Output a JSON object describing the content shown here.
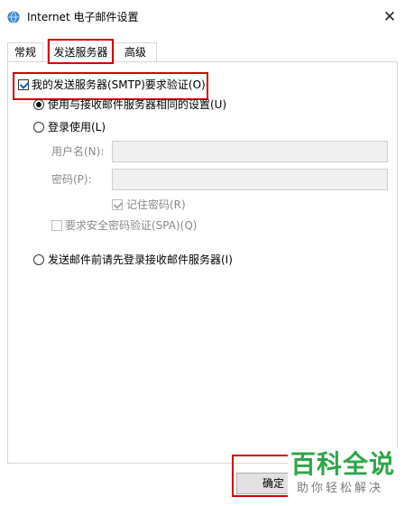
{
  "window": {
    "title": "Internet 电子邮件设置",
    "close_glyph": "✕"
  },
  "tabs": [
    {
      "label": "常规"
    },
    {
      "label": "发送服务器"
    },
    {
      "label": "高级"
    }
  ],
  "outgoing": {
    "require_auth_label": "我的发送服务器(SMTP)要求验证(O)",
    "require_auth_checked": true,
    "use_same_label": "使用与接收邮件服务器相同的设置(U)",
    "use_same_selected": true,
    "login_with_label": "登录使用(L)",
    "login_with_selected": false,
    "username_label": "用户名(N):",
    "username_value": "",
    "password_label": "密码(P):",
    "password_value": "",
    "remember_password_label": "记住密码(R)",
    "remember_password_checked": true,
    "spa_label": "要求安全密码验证(SPA)(Q)",
    "spa_checked": false,
    "login_incoming_first_label": "发送邮件前请先登录接收邮件服务器(I)",
    "login_incoming_first_selected": false
  },
  "buttons": {
    "ok_label": "确定"
  },
  "watermark": {
    "brand": "百科全说",
    "tagline": "助你轻松解决"
  },
  "colors": {
    "highlight": "#d40000",
    "brand_green": "#2fa54a",
    "check_blue": "#0b5cc0"
  },
  "icons": {
    "app": "envelope-globe-icon",
    "close": "close-icon"
  }
}
